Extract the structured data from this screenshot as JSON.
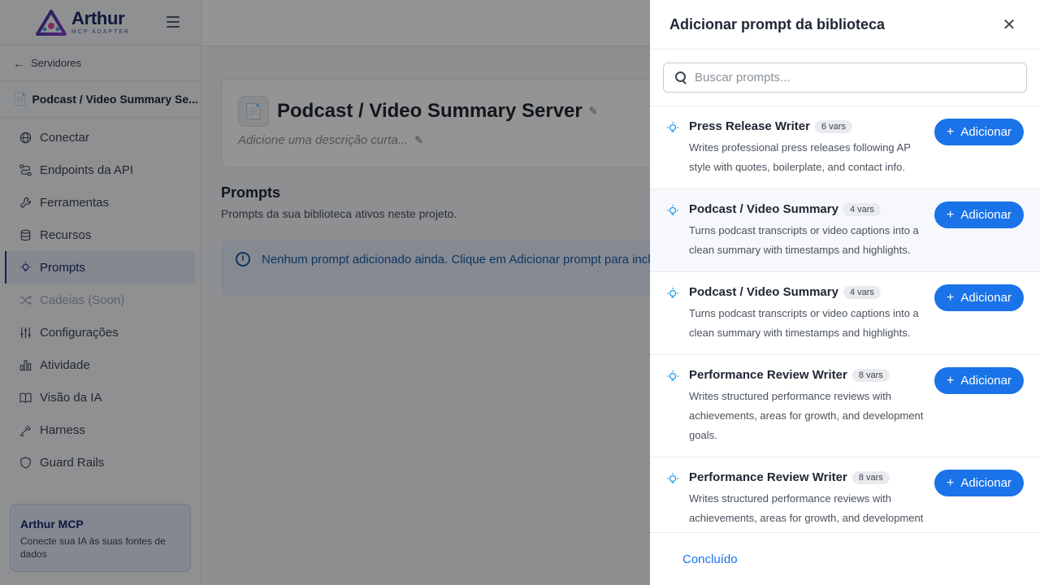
{
  "brand": {
    "name": "Arthur",
    "subtitle": "MCP ADAPTER"
  },
  "sidebar": {
    "back_label": "Servidores",
    "server_name": "Podcast / Video Summary Se...",
    "items": [
      {
        "label": "Conectar",
        "icon": "globe-icon"
      },
      {
        "label": "Endpoints da API",
        "icon": "route-icon"
      },
      {
        "label": "Ferramentas",
        "icon": "wrench-icon"
      },
      {
        "label": "Recursos",
        "icon": "database-icon"
      },
      {
        "label": "Prompts",
        "icon": "bulb-icon"
      },
      {
        "label": "Cadeias (Soon)",
        "icon": "shuffle-icon"
      },
      {
        "label": "Configurações",
        "icon": "sliders-icon"
      },
      {
        "label": "Atividade",
        "icon": "bar-chart-icon"
      },
      {
        "label": "Visão da IA",
        "icon": "book-icon"
      },
      {
        "label": "Harness",
        "icon": "harness-icon"
      },
      {
        "label": "Guard Rails",
        "icon": "shield-icon"
      }
    ],
    "promo": {
      "title": "Arthur MCP",
      "text": "Conecte sua IA às suas fontes de dados"
    }
  },
  "main": {
    "title": "Podcast / Video Summary Server",
    "description": "Adicione uma descrição curta...",
    "section_title": "Prompts",
    "section_subtitle": "Prompts da sua biblioteca ativos neste projeto.",
    "empty_alert": "Nenhum prompt adicionado ainda. Clique em Adicionar prompt para incluir novos."
  },
  "drawer": {
    "title": "Adicionar prompt da biblioteca",
    "search_placeholder": "Buscar prompts...",
    "add_label": "Adicionar",
    "done_label": "Concluído",
    "items": [
      {
        "name": "Press Release Writer",
        "vars": "6 vars",
        "description": "Writes professional press releases following AP style with quotes, boilerplate, and contact info."
      },
      {
        "name": "Podcast / Video Summary",
        "vars": "4 vars",
        "description": "Turns podcast transcripts or video captions into a clean summary with timestamps and highlights."
      },
      {
        "name": "Podcast / Video Summary",
        "vars": "4 vars",
        "description": "Turns podcast transcripts or video captions into a clean summary with timestamps and highlights."
      },
      {
        "name": "Performance Review Writer",
        "vars": "8 vars",
        "description": "Writes structured performance reviews with achievements, areas for growth, and development goals."
      },
      {
        "name": "Performance Review Writer",
        "vars": "8 vars",
        "description": "Writes structured performance reviews with achievements, areas for growth, and development goals."
      }
    ]
  },
  "colors": {
    "primary": "#1a73e8",
    "brand": "#1d2a6b",
    "alert_bg": "#e5eefb",
    "alert_text": "#1a5ba8"
  }
}
